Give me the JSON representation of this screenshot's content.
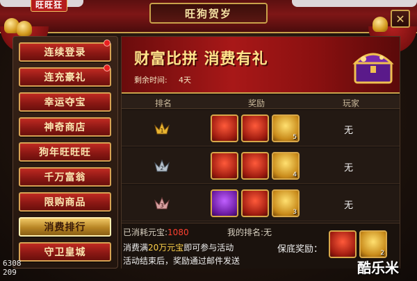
{
  "window": {
    "title": "旺狗贺岁",
    "logo_text": "旺旺狂",
    "close_label": "✕"
  },
  "sidebar": {
    "items": [
      {
        "label": "连续登录",
        "badge": true
      },
      {
        "label": "连充豪礼",
        "badge": true
      },
      {
        "label": "幸运夺宝",
        "badge": false
      },
      {
        "label": "神奇商店",
        "badge": false
      },
      {
        "label": "狗年旺旺旺",
        "badge": false
      },
      {
        "label": "千万富翁",
        "badge": false
      },
      {
        "label": "限购商品",
        "badge": false
      },
      {
        "label": "消费排行",
        "badge": false,
        "active": true
      },
      {
        "label": "守卫皇城",
        "badge": false
      }
    ]
  },
  "banner": {
    "title": "财富比拼  消费有礼",
    "time_label": "剩余时间:",
    "time_value": "4天"
  },
  "table": {
    "headers": {
      "rank": "排名",
      "reward": "奖励",
      "player": "玩家"
    },
    "rows": [
      {
        "rank_icon": "gold-rank-1-icon",
        "rewards": [
          {
            "type": "red-chest"
          },
          {
            "type": "red-chest"
          },
          {
            "type": "gold-bar",
            "qty": "5"
          }
        ],
        "player": "无"
      },
      {
        "rank_icon": "silver-rank-2-icon",
        "rewards": [
          {
            "type": "red-chest"
          },
          {
            "type": "red-chest"
          },
          {
            "type": "gold-bar",
            "qty": "4"
          }
        ],
        "player": "无"
      },
      {
        "rank_icon": "bronze-rank-3-icon",
        "rewards": [
          {
            "type": "purple-chest"
          },
          {
            "type": "red-chest"
          },
          {
            "type": "gold-bar",
            "qty": "3"
          }
        ],
        "player": "无"
      }
    ]
  },
  "footer": {
    "consumed_label": "已消耗元宝:",
    "consumed_value": "1080",
    "myrank_label": "我的排名:",
    "myrank_value": "无",
    "line1_pre": "消费满",
    "line1_highlight": "20万元宝",
    "line1_post": "即可参与活动",
    "line2": "活动结束后，奖励通过邮件发送",
    "guarantee_label": "保底奖励：",
    "guarantee_rewards": [
      {
        "type": "red-chest"
      },
      {
        "type": "gold-bar",
        "qty": "2"
      }
    ]
  },
  "overlay": {
    "coord_line1": "6308",
    "coord_line2": "209",
    "watermark": "酷乐米"
  },
  "colors": {
    "accent_gold": "#c9a24a",
    "banner_red": "#a81818",
    "consumed_red": "#ff4030",
    "highlight_yellow": "#ffd24a"
  }
}
